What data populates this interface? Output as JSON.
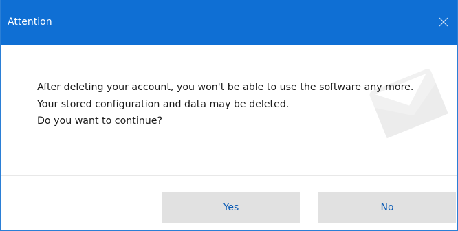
{
  "window": {
    "title": "Attention",
    "close_icon": "close-icon",
    "accent_color": "#0f6fd4"
  },
  "message": {
    "lines": [
      "After deleting your account, you won't be able to use the software any more.",
      "Your stored configuration and data may be deleted.",
      "Do you want to continue?"
    ]
  },
  "buttons": {
    "yes_label": "Yes",
    "no_label": "No",
    "label_color": "#0b5bb5",
    "background_color": "#e1e1e1"
  },
  "watermark": {
    "icon": "envelope-icon"
  }
}
